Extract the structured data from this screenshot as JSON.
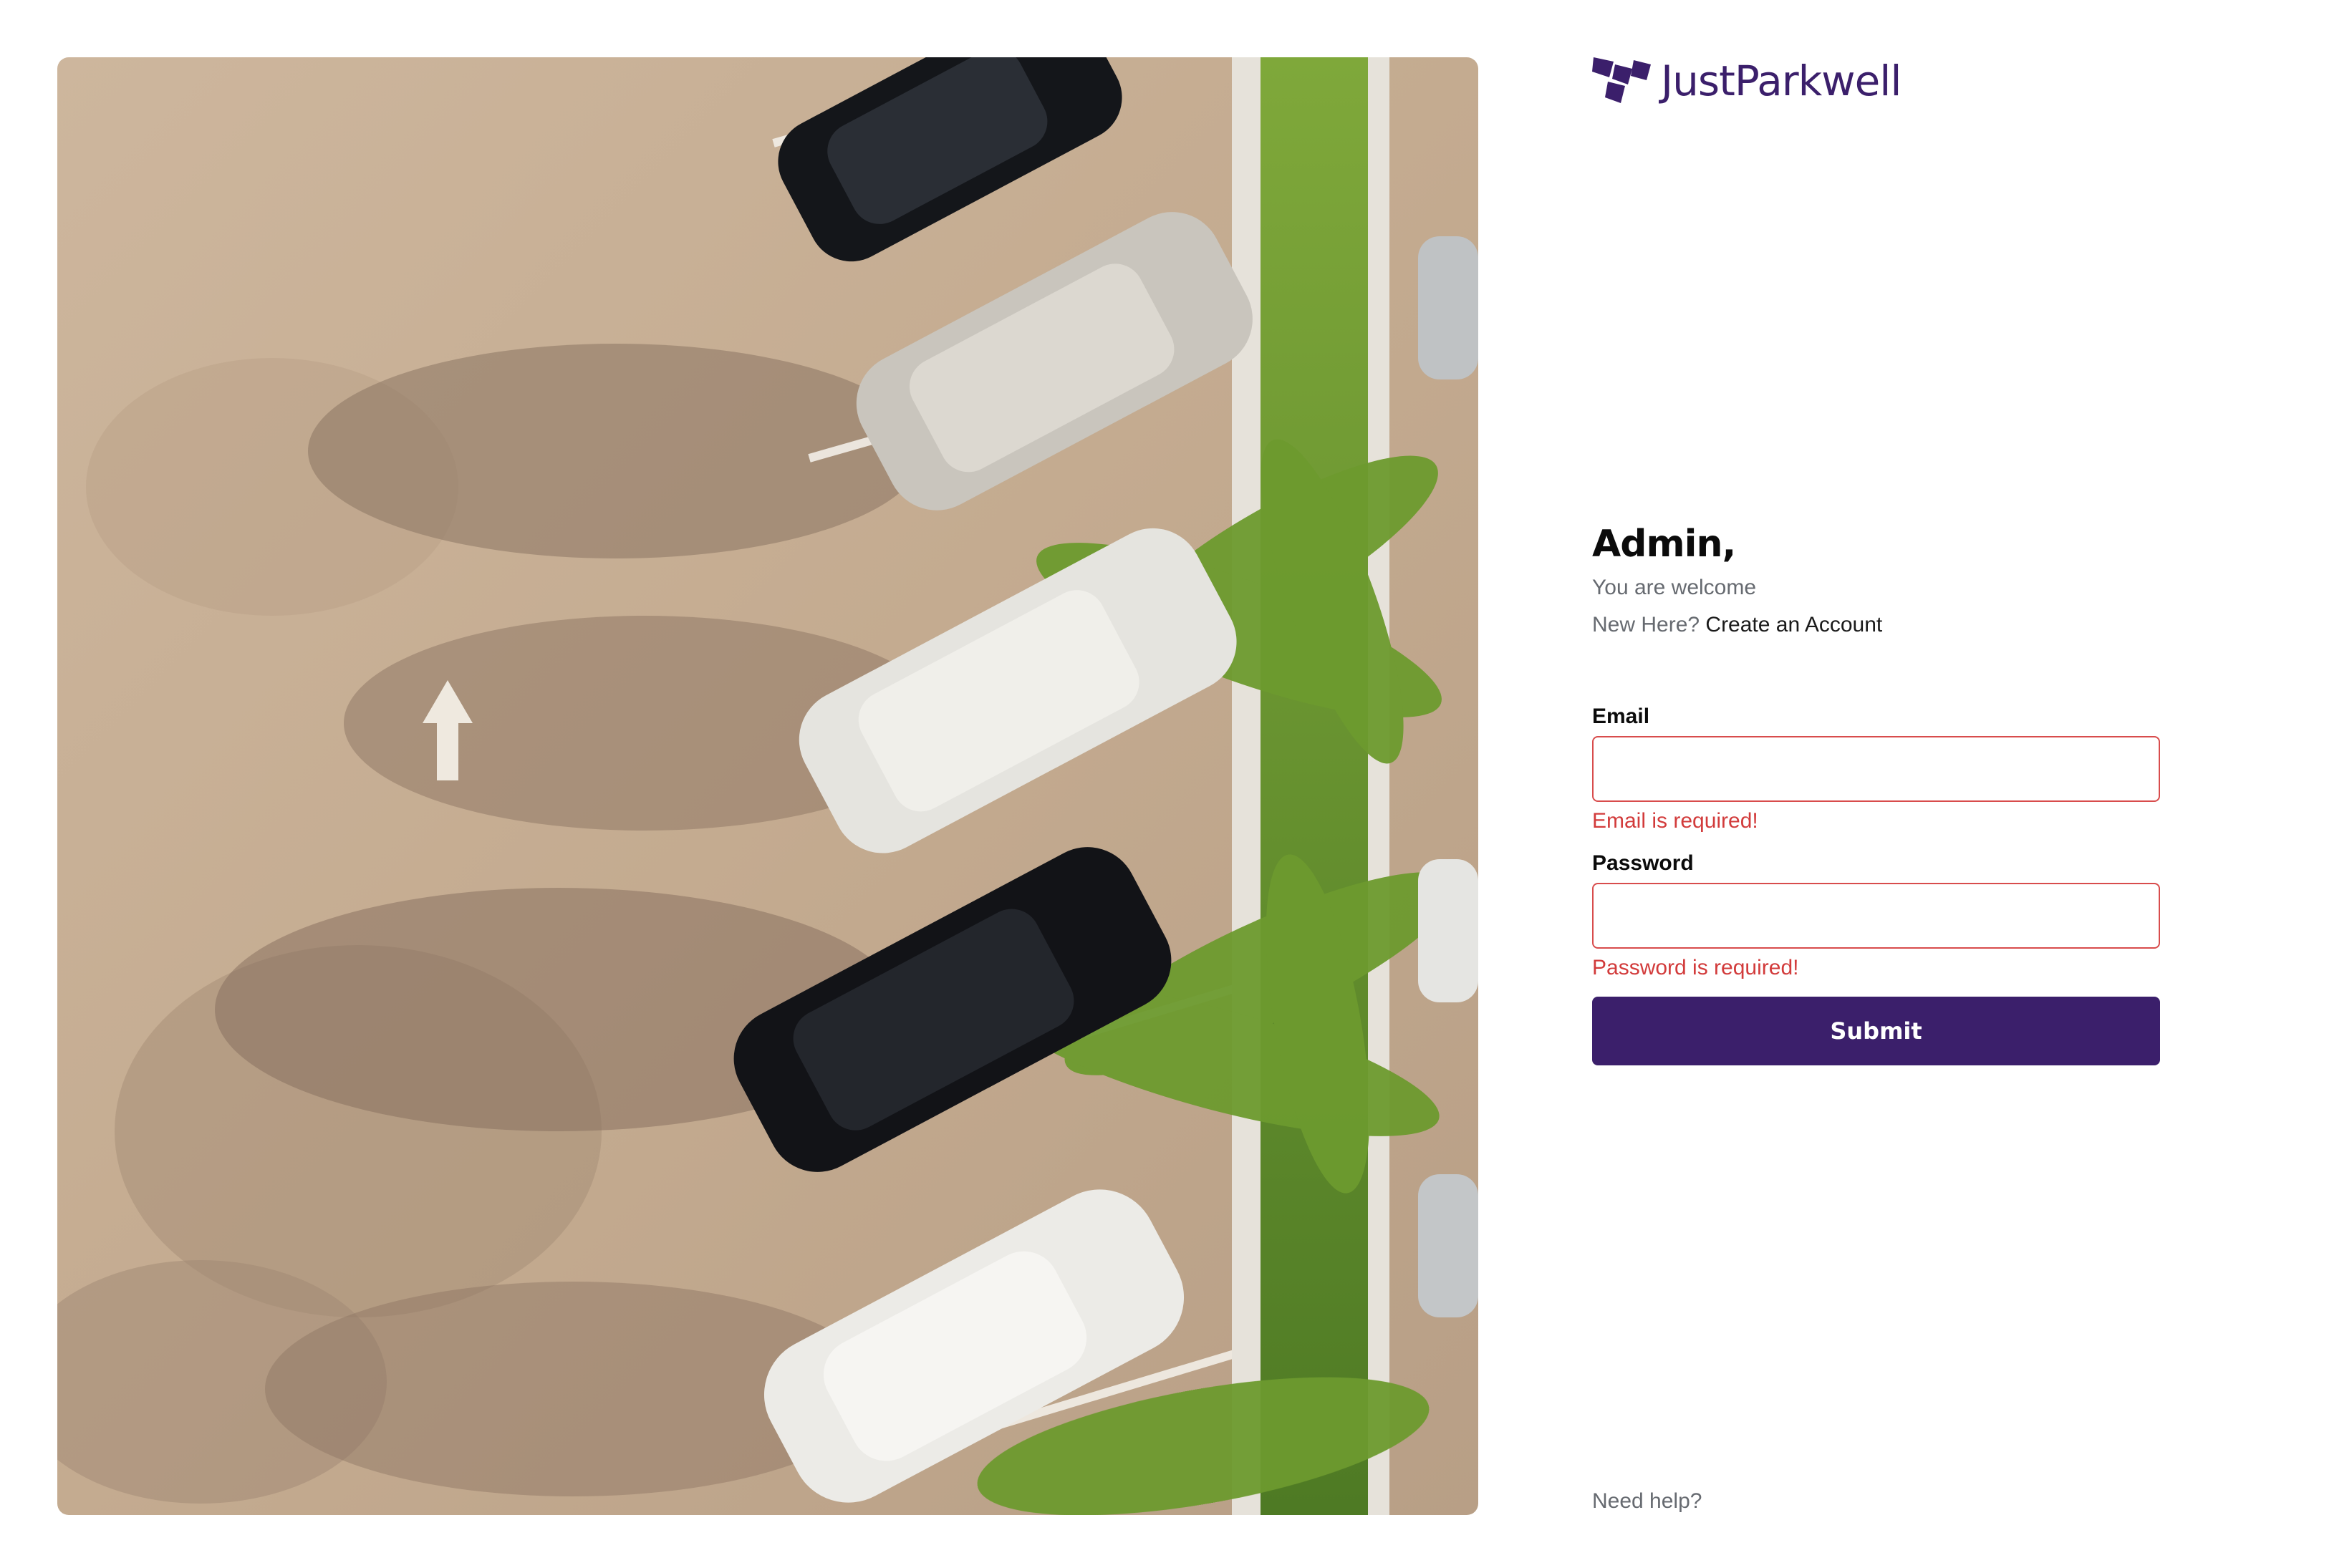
{
  "brand": {
    "name": "JustParkwell",
    "color": "#3b1f6b"
  },
  "greeting": {
    "title": "Admin,",
    "subtitle": "You are welcome",
    "signup_prompt": "New Here?",
    "signup_link": "Create an Account"
  },
  "form": {
    "email": {
      "label": "Email",
      "value": "",
      "error": "Email is required!"
    },
    "password": {
      "label": "Password",
      "value": "",
      "error": "Password is required!"
    },
    "submit_label": "Submit"
  },
  "footer": {
    "help_link": "Need help?"
  },
  "colors": {
    "accent": "#3b1f6b",
    "error": "#d23b3b",
    "muted_text": "#666a70"
  }
}
